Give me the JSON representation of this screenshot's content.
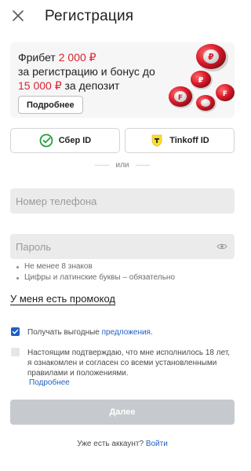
{
  "header": {
    "title": "Регистрация",
    "close_icon": "close-icon"
  },
  "banner": {
    "line1_prefix": "Фрибет ",
    "line1_amount": "2 000 ₽",
    "line2": "за регистрацию и бонус до",
    "line3_amount": "15 000 ₽",
    "line3_suffix": " за депозит",
    "more_label": "Подробнее",
    "accent_color": "#e01f2f"
  },
  "id_buttons": {
    "sber_label": "Сбер ID",
    "tinkoff_label": "Tinkoff ID"
  },
  "divider_text": "или",
  "phone": {
    "placeholder": "Номер телефона",
    "value": ""
  },
  "password": {
    "placeholder": "Пароль",
    "value": ""
  },
  "password_hints": [
    "Не менее 8 знаков",
    "Цифры и латинские буквы – обязательно"
  ],
  "promo_label": "У меня есть промокод",
  "offers_checkbox": {
    "checked": true,
    "text": "Получать выгодные ",
    "link": "предложения",
    "suffix": "."
  },
  "terms_checkbox": {
    "checked": false,
    "text": "Настоящим подтверждаю, что мне исполнилось 18 лет, я ознакомлен и согласен со всеми установленными правилами и положениями.",
    "more_label": "Подробнее"
  },
  "submit_label": "Далее",
  "login": {
    "text": "Уже есть аккаунт? ",
    "link": "Войти"
  },
  "colors": {
    "link": "#1f5fc4",
    "field_bg": "#ebebeb",
    "disabled_button": "#c6c9ce"
  }
}
